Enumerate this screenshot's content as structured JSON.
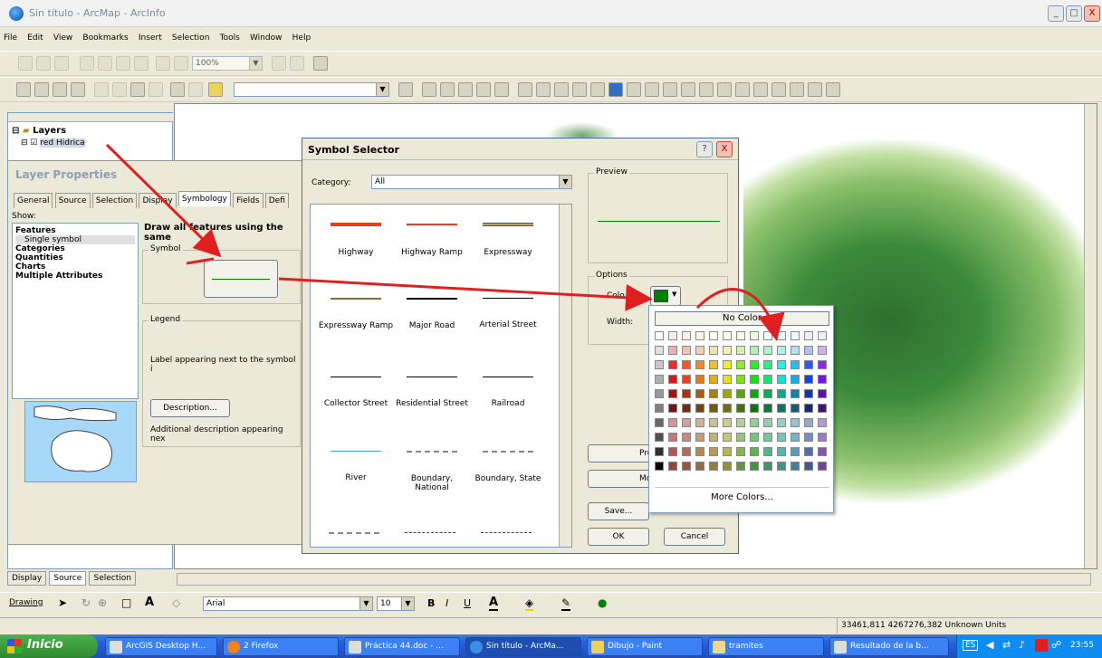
{
  "window": {
    "title": "Sin título - ArcMap - ArcInfo",
    "controls": [
      "_",
      "□",
      "X"
    ]
  },
  "menu": [
    "File",
    "Edit",
    "View",
    "Bookmarks",
    "Insert",
    "Selection",
    "Tools",
    "Window",
    "Help"
  ],
  "toolbar": {
    "zoom": "100%"
  },
  "toc": {
    "root": "Layers",
    "layer": "red Hidrica"
  },
  "layer_properties": {
    "title": "Layer Properties",
    "tabs": [
      "General",
      "Source",
      "Selection",
      "Display",
      "Symbology",
      "Fields",
      "Defi"
    ],
    "show_label": "Show:",
    "show_items": [
      "Features",
      "Single symbol",
      "Categories",
      "Quantities",
      "Charts",
      "Multiple Attributes"
    ],
    "heading": "Draw all features using the same",
    "symbol_label": "Symbol",
    "legend_label": "Legend",
    "legend_text": "Label appearing next to the symbol i",
    "description_button": "Description...",
    "description_text": "Additional description appearing nex"
  },
  "symbol_selector": {
    "title": "Symbol Selector",
    "help": "?",
    "close": "X",
    "category_label": "Category:",
    "category_value": "All",
    "preview_label": "Preview",
    "options_label": "Options",
    "color_label": "Colo",
    "width_label": "Width:",
    "symbols": [
      "Highway",
      "Highway Ramp",
      "Expressway",
      "Expressway Ramp",
      "Major Road",
      "Arterial Street",
      "Collector Street",
      "Residential Street",
      "Railroad",
      "River",
      "Boundary, National",
      "Boundary, State"
    ],
    "buttons": {
      "properties": "Prop",
      "more": "More",
      "save": "Save...",
      "ok": "OK",
      "cancel": "Cancel"
    }
  },
  "palette": {
    "no_color": "No Color",
    "more_colors": "More Colors..."
  },
  "bottom_tabs": [
    "Display",
    "Source",
    "Selection"
  ],
  "draw_bar": {
    "drawing": "Drawing",
    "font": "Arial",
    "size": "10",
    "bold": "B",
    "italic": "I",
    "underline": "U"
  },
  "status": {
    "coords": "33461,811  4267276,382 Unknown Units"
  },
  "taskbar": {
    "start": "Inicio",
    "tasks": [
      "ArcGIS Desktop H...",
      "2 Firefox",
      "Práctica 44.doc - ...",
      "Sin título - ArcMa...",
      "Dibujo - Paint",
      "tramites",
      "Resultado de la b..."
    ],
    "language": "ES",
    "time": "23:55"
  },
  "colors": {
    "selected_line": "#008000",
    "arrow": "#e02020",
    "map_features": "#2f6f2f"
  }
}
